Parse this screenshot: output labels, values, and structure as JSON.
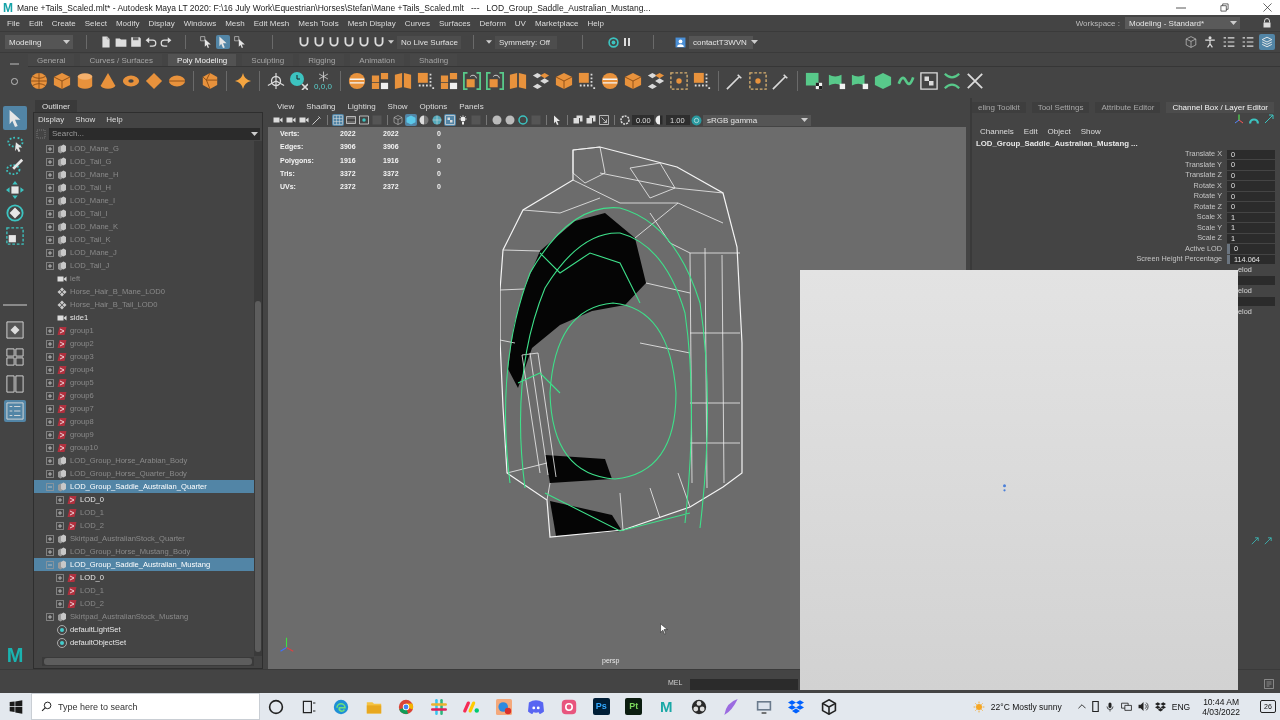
{
  "title_bar": {
    "app_letter": "M",
    "title": "Mane +Tails_Scaled.mlt* - Autodesk Maya LT 2020: F:\\16 July Work\\Equestrian\\Horses\\Stefan\\Mane +Tails_Scaled.mlt   ---   LOD_Group_Saddle_Australian_Mustang..."
  },
  "menu_bar": {
    "items": [
      "File",
      "Edit",
      "Create",
      "Select",
      "Modify",
      "Display",
      "Windows",
      "Mesh",
      "Edit Mesh",
      "Mesh Tools",
      "Mesh Display",
      "Curves",
      "Surfaces",
      "Deform",
      "UV",
      "Marketplace",
      "Help"
    ],
    "workspace_label": "Workspace :",
    "workspace": "Modeling - Standard*"
  },
  "status_line": {
    "mode": "Modeling",
    "select_modes": [
      {
        "selected": false
      },
      {
        "selected": true
      },
      {
        "selected": false
      }
    ],
    "live_surface": "No Live Surface",
    "symmetry": "Symmetry: Off",
    "user": "contactT3WVN",
    "panel_toggles": [
      {
        "on": false
      },
      {
        "on": false
      },
      {
        "on": false
      },
      {
        "on": false
      },
      {
        "on": true
      }
    ]
  },
  "shelf": {
    "tabs": [
      {
        "label": "General",
        "selected": false
      },
      {
        "label": "Curves / Surfaces",
        "selected": false
      },
      {
        "label": "Poly Modeling",
        "selected": true
      },
      {
        "label": "Sculpting",
        "selected": false
      },
      {
        "label": "Rigging",
        "selected": false
      },
      {
        "label": "Animation",
        "selected": false
      },
      {
        "label": "Shading",
        "selected": false
      }
    ],
    "origin_caption": "0,0,0"
  },
  "toolbox": {
    "tools": [
      {
        "selected": true
      },
      {
        "selected": false
      },
      {
        "selected": false
      },
      {
        "selected": false
      },
      {
        "selected": false
      },
      {
        "selected": false
      }
    ],
    "layouts": [
      {
        "selected": false
      },
      {
        "selected": false
      },
      {
        "selected": false
      },
      {
        "selected": true
      }
    ],
    "logo_letter": "M"
  },
  "outliner": {
    "title": "Outliner",
    "menus": [
      "Display",
      "Show",
      "Help"
    ],
    "search": {
      "placeholder": "Search..."
    },
    "items": [
      {
        "label": "LOD_Mane_G",
        "kind": "lod_group",
        "dimmed": true,
        "selected": false,
        "expanded": false
      },
      {
        "label": "LOD_Tail_G",
        "kind": "lod_group",
        "dimmed": true,
        "selected": false,
        "expanded": false
      },
      {
        "label": "LOD_Mane_H",
        "kind": "lod_group",
        "dimmed": true,
        "selected": false,
        "expanded": false
      },
      {
        "label": "LOD_Tail_H",
        "kind": "lod_group",
        "dimmed": true,
        "selected": false,
        "expanded": false
      },
      {
        "label": "LOD_Mane_I",
        "kind": "lod_group",
        "dimmed": true,
        "selected": false,
        "expanded": false
      },
      {
        "label": "LOD_Tail_I",
        "kind": "lod_group",
        "dimmed": true,
        "selected": false,
        "expanded": false
      },
      {
        "label": "LOD_Mane_K",
        "kind": "lod_group",
        "dimmed": true,
        "selected": false,
        "expanded": false
      },
      {
        "label": "LOD_Tail_K",
        "kind": "lod_group",
        "dimmed": true,
        "selected": false,
        "expanded": false
      },
      {
        "label": "LOD_Mane_J",
        "kind": "lod_group",
        "dimmed": true,
        "selected": false,
        "expanded": false
      },
      {
        "label": "LOD_Tail_J",
        "kind": "lod_group",
        "dimmed": true,
        "selected": false,
        "expanded": false
      },
      {
        "label": "left",
        "kind": "camera",
        "dimmed": true,
        "selected": false
      },
      {
        "label": "Horse_Hair_B_Mane_LOD0",
        "kind": "locator",
        "dimmed": true,
        "selected": false
      },
      {
        "label": "Horse_Hair_B_Tail_LOD0",
        "kind": "locator",
        "dimmed": true,
        "selected": false
      },
      {
        "label": "side1",
        "kind": "camera",
        "dimmed": false,
        "selected": false
      },
      {
        "label": "group1",
        "kind": "transform",
        "dimmed": true,
        "selected": false,
        "expanded": false
      },
      {
        "label": "group2",
        "kind": "transform",
        "dimmed": true,
        "selected": false,
        "expanded": false
      },
      {
        "label": "group3",
        "kind": "transform",
        "dimmed": true,
        "selected": false,
        "expanded": false
      },
      {
        "label": "group4",
        "kind": "transform",
        "dimmed": true,
        "selected": false,
        "expanded": false
      },
      {
        "label": "group5",
        "kind": "transform",
        "dimmed": true,
        "selected": false,
        "expanded": false
      },
      {
        "label": "group6",
        "kind": "transform",
        "dimmed": true,
        "selected": false,
        "expanded": false
      },
      {
        "label": "group7",
        "kind": "transform",
        "dimmed": true,
        "selected": false,
        "expanded": false
      },
      {
        "label": "group8",
        "kind": "transform",
        "dimmed": true,
        "selected": false,
        "expanded": false
      },
      {
        "label": "group9",
        "kind": "transform",
        "dimmed": true,
        "selected": false,
        "expanded": false
      },
      {
        "label": "group10",
        "kind": "transform",
        "dimmed": true,
        "selected": false,
        "expanded": false
      },
      {
        "label": "LOD_Group_Horse_Arabian_Body",
        "kind": "lod_group",
        "dimmed": true,
        "selected": false,
        "expanded": false
      },
      {
        "label": "LOD_Group_Horse_Quarter_Body",
        "kind": "lod_group",
        "dimmed": true,
        "selected": false,
        "expanded": false
      },
      {
        "label": "LOD_Group_Saddle_Australian_Quarter",
        "kind": "lod_group",
        "dimmed": false,
        "selected": true,
        "expanded": true,
        "children": [
          {
            "label": "LOD_0",
            "kind": "transform",
            "dimmed": false,
            "selected": false,
            "expanded": false
          },
          {
            "label": "LOD_1",
            "kind": "transform",
            "dimmed": true,
            "selected": false,
            "expanded": false
          },
          {
            "label": "LOD_2",
            "kind": "transform",
            "dimmed": true,
            "selected": false,
            "expanded": false
          }
        ]
      },
      {
        "label": "Skirtpad_AustralianStock_Quarter",
        "kind": "lod_group",
        "dimmed": true,
        "selected": false,
        "expanded": false
      },
      {
        "label": "LOD_Group_Horse_Mustang_Body",
        "kind": "lod_group",
        "dimmed": true,
        "selected": false,
        "expanded": false
      },
      {
        "label": "LOD_Group_Saddle_Australian_Mustang",
        "kind": "lod_group",
        "dimmed": false,
        "selected": true,
        "expanded": true,
        "children": [
          {
            "label": "LOD_0",
            "kind": "transform",
            "dimmed": false,
            "selected": false,
            "expanded": false
          },
          {
            "label": "LOD_1",
            "kind": "transform",
            "dimmed": true,
            "selected": false,
            "expanded": false
          },
          {
            "label": "LOD_2",
            "kind": "transform",
            "dimmed": true,
            "selected": false,
            "expanded": false
          }
        ]
      },
      {
        "label": "Skirtpad_AustralianStock_Mustang",
        "kind": "lod_group",
        "dimmed": true,
        "selected": false,
        "expanded": false
      },
      {
        "label": "defaultLightSet",
        "kind": "set",
        "dimmed": false,
        "selected": false
      },
      {
        "label": "defaultObjectSet",
        "kind": "set",
        "dimmed": false,
        "selected": false
      }
    ]
  },
  "viewport": {
    "menus": [
      "View",
      "Shading",
      "Lighting",
      "Show",
      "Options",
      "Panels"
    ],
    "toggles": [
      {
        "on": false
      },
      {
        "on": false
      },
      {
        "on": false
      },
      {
        "on": false
      },
      {
        "on": true
      },
      {
        "on": false
      },
      {
        "on": false
      },
      {
        "on": false
      },
      {
        "on": false
      },
      {
        "on": true
      },
      {
        "on": false
      },
      {
        "on": false
      },
      {
        "on": true
      },
      {
        "on": false
      },
      {
        "on": false
      },
      {
        "on": false
      },
      {
        "on": false
      },
      {
        "on": false
      },
      {
        "on": false
      },
      {
        "on": false
      },
      {
        "on": false
      },
      {
        "on": false
      },
      {
        "on": false
      },
      {
        "on": false
      }
    ],
    "exposure": "0.00",
    "gamma": "1.00",
    "color_space": "sRGB gamma",
    "stats": [
      {
        "label": "Verts:",
        "values": [
          "2022",
          "2022",
          "0"
        ]
      },
      {
        "label": "Edges:",
        "values": [
          "3906",
          "3906",
          "0"
        ]
      },
      {
        "label": "Polygons:",
        "values": [
          "1916",
          "1916",
          "0"
        ]
      },
      {
        "label": "Tris:",
        "values": [
          "3372",
          "3372",
          "0"
        ]
      },
      {
        "label": "UVs:",
        "values": [
          "2372",
          "2372",
          "0"
        ]
      }
    ],
    "camera": "persp"
  },
  "channel_box": {
    "tabs": [
      {
        "label": "eling Toolkit",
        "selected": false
      },
      {
        "label": "Tool Settings",
        "selected": false
      },
      {
        "label": "Attribute Editor",
        "selected": false
      },
      {
        "label": "Channel Box / Layer Editor",
        "selected": true
      }
    ],
    "menus": [
      "Channels",
      "Edit",
      "Object",
      "Show"
    ],
    "object": "LOD_Group_Saddle_Australian_Mustang ...",
    "channels": [
      {
        "label": "Translate X",
        "value": "0",
        "kind": "keyable"
      },
      {
        "label": "Translate Y",
        "value": "0",
        "kind": "keyable"
      },
      {
        "label": "Translate Z",
        "value": "0",
        "kind": "keyable"
      },
      {
        "label": "Rotate X",
        "value": "0",
        "kind": "keyable"
      },
      {
        "label": "Rotate Y",
        "value": "0",
        "kind": "keyable"
      },
      {
        "label": "Rotate Z",
        "value": "0",
        "kind": "keyable"
      },
      {
        "label": "Scale X",
        "value": "1",
        "kind": "keyable"
      },
      {
        "label": "Scale Y",
        "value": "1",
        "kind": "keyable"
      },
      {
        "label": "Scale Z",
        "value": "1",
        "kind": "keyable"
      },
      {
        "label": "Active LOD",
        "value": "0",
        "kind": "nonkeyable"
      },
      {
        "label": "Screen Height Percentage",
        "value": "114.064",
        "kind": "nonkeyable"
      }
    ],
    "cut_values": [
      "elod",
      "elod",
      "elod"
    ]
  },
  "command_line": {
    "language": "MEL"
  },
  "taskbar": {
    "search": {
      "placeholder": "Type here to search"
    },
    "app_labels": [
      "Ps",
      "Pt",
      "M"
    ],
    "weather": "22°C Mostly sunny",
    "language": "ENG",
    "time": "10:44 AM",
    "date": "4/03/2022",
    "notifications": "26"
  }
}
